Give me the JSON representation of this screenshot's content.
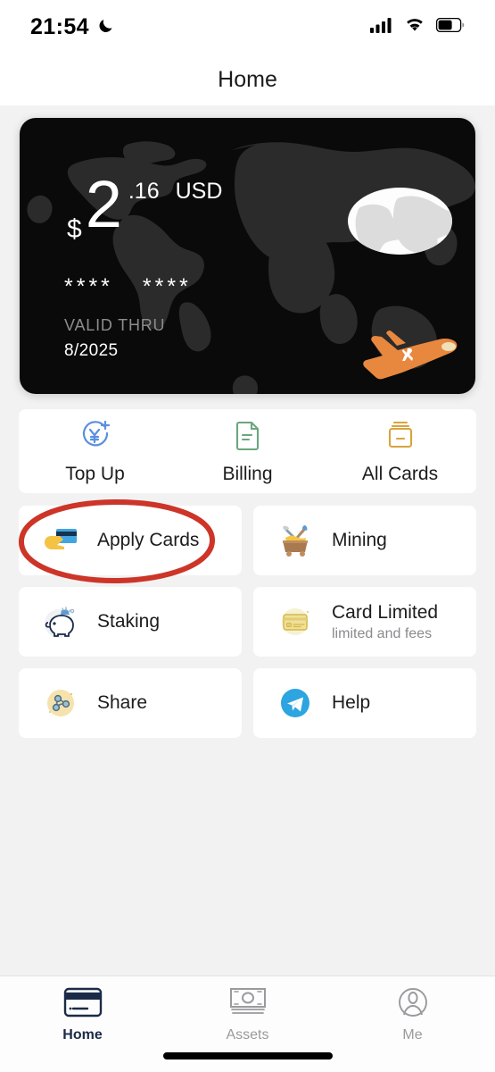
{
  "status_bar": {
    "time": "21:54",
    "dnd_icon": "crescent-moon-icon",
    "signal_icon": "cellular-signal-icon",
    "wifi_icon": "wifi-icon",
    "battery_icon": "battery-icon"
  },
  "header": {
    "title": "Home"
  },
  "card": {
    "currency_symbol": "$",
    "amount_integer": "2",
    "amount_decimal": ".16",
    "currency_code": "USD",
    "masked_number_group1": "****",
    "masked_number_group2": "****",
    "valid_thru_label": "VALID THRU",
    "valid_thru_date": "8/2025",
    "background_color": "#0a0a0a",
    "map_color": "#2b2b2b",
    "plane_color": "#e8883f",
    "logo_icon": "globe-logo-icon",
    "plane_icon": "airplane-icon"
  },
  "quick_actions": [
    {
      "label": "Top Up",
      "icon": "top-up-icon",
      "color": "#5a8fe0"
    },
    {
      "label": "Billing",
      "icon": "billing-document-icon",
      "color": "#6aa77e"
    },
    {
      "label": "All Cards",
      "icon": "all-cards-icon",
      "color": "#d8a43c"
    }
  ],
  "tiles": [
    {
      "title": "Apply Cards",
      "subtitle": "",
      "icon": "hand-holding-card-icon"
    },
    {
      "title": "Mining",
      "subtitle": "",
      "icon": "mine-cart-icon"
    },
    {
      "title": "Staking",
      "subtitle": "",
      "icon": "piggy-bank-icon"
    },
    {
      "title": "Card Limited",
      "subtitle": "limited and fees",
      "icon": "gold-card-icon"
    },
    {
      "title": "Share",
      "subtitle": "",
      "icon": "share-network-icon"
    },
    {
      "title": "Help",
      "subtitle": "",
      "icon": "telegram-icon"
    }
  ],
  "annotation": {
    "shape": "red-ellipse-highlight",
    "target": "Apply Cards",
    "color": "#cc3528"
  },
  "tab_bar": {
    "items": [
      {
        "label": "Home",
        "icon": "credit-card-icon",
        "active": true
      },
      {
        "label": "Assets",
        "icon": "banknote-icon",
        "active": false
      },
      {
        "label": "Me",
        "icon": "person-circle-icon",
        "active": false
      }
    ],
    "active_color": "#1b2a47",
    "inactive_color": "#9a9a9e"
  }
}
